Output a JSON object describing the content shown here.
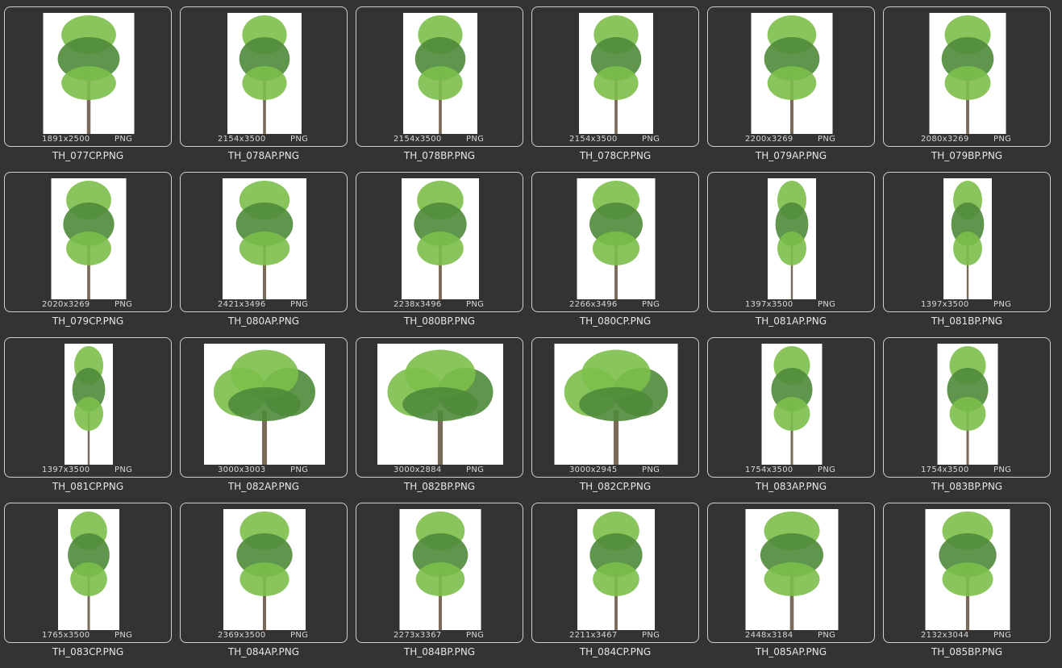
{
  "files": [
    {
      "name": "TH_077CP.PNG",
      "dims": "1891x2500",
      "format": "PNG",
      "icon": "tree-thumbnail-icon"
    },
    {
      "name": "TH_078AP.PNG",
      "dims": "2154x3500",
      "format": "PNG",
      "icon": "tree-thumbnail-icon"
    },
    {
      "name": "TH_078BP.PNG",
      "dims": "2154x3500",
      "format": "PNG",
      "icon": "tree-thumbnail-icon"
    },
    {
      "name": "TH_078CP.PNG",
      "dims": "2154x3500",
      "format": "PNG",
      "icon": "tree-thumbnail-icon"
    },
    {
      "name": "TH_079AP.PNG",
      "dims": "2200x3269",
      "format": "PNG",
      "icon": "tree-thumbnail-icon"
    },
    {
      "name": "TH_079BP.PNG",
      "dims": "2080x3269",
      "format": "PNG",
      "icon": "tree-thumbnail-icon"
    },
    {
      "name": "TH_079CP.PNG",
      "dims": "2020x3269",
      "format": "PNG",
      "icon": "tree-thumbnail-icon"
    },
    {
      "name": "TH_080AP.PNG",
      "dims": "2421x3496",
      "format": "PNG",
      "icon": "tree-thumbnail-icon"
    },
    {
      "name": "TH_080BP.PNG",
      "dims": "2238x3496",
      "format": "PNG",
      "icon": "tree-thumbnail-icon"
    },
    {
      "name": "TH_080CP.PNG",
      "dims": "2266x3496",
      "format": "PNG",
      "icon": "tree-thumbnail-icon"
    },
    {
      "name": "TH_081AP.PNG",
      "dims": "1397x3500",
      "format": "PNG",
      "icon": "tree-thumbnail-icon"
    },
    {
      "name": "TH_081BP.PNG",
      "dims": "1397x3500",
      "format": "PNG",
      "icon": "tree-thumbnail-icon"
    },
    {
      "name": "TH_081CP.PNG",
      "dims": "1397x3500",
      "format": "PNG",
      "icon": "tree-thumbnail-icon"
    },
    {
      "name": "TH_082AP.PNG",
      "dims": "3000x3003",
      "format": "PNG",
      "icon": "tree-thumbnail-icon"
    },
    {
      "name": "TH_082BP.PNG",
      "dims": "3000x2884",
      "format": "PNG",
      "icon": "tree-thumbnail-icon"
    },
    {
      "name": "TH_082CP.PNG",
      "dims": "3000x2945",
      "format": "PNG",
      "icon": "tree-thumbnail-icon"
    },
    {
      "name": "TH_083AP.PNG",
      "dims": "1754x3500",
      "format": "PNG",
      "icon": "tree-thumbnail-icon"
    },
    {
      "name": "TH_083BP.PNG",
      "dims": "1754x3500",
      "format": "PNG",
      "icon": "tree-thumbnail-icon"
    },
    {
      "name": "TH_083CP.PNG",
      "dims": "1765x3500",
      "format": "PNG",
      "icon": "tree-thumbnail-icon"
    },
    {
      "name": "TH_084AP.PNG",
      "dims": "2369x3500",
      "format": "PNG",
      "icon": "tree-thumbnail-icon"
    },
    {
      "name": "TH_084BP.PNG",
      "dims": "2273x3367",
      "format": "PNG",
      "icon": "tree-thumbnail-icon"
    },
    {
      "name": "TH_084CP.PNG",
      "dims": "2211x3467",
      "format": "PNG",
      "icon": "tree-thumbnail-icon"
    },
    {
      "name": "TH_085AP.PNG",
      "dims": "2448x3184",
      "format": "PNG",
      "icon": "tree-thumbnail-icon"
    },
    {
      "name": "TH_085BP.PNG",
      "dims": "2132x3044",
      "format": "PNG",
      "icon": "tree-thumbnail-icon"
    }
  ],
  "colors": {
    "background": "#333333",
    "card_border": "#cfcfcf",
    "thumb_background": "#ffffff",
    "foliage_light": "#7cbf4a",
    "foliage_dark": "#4f8a3a",
    "trunk": "#7a6a5a"
  }
}
